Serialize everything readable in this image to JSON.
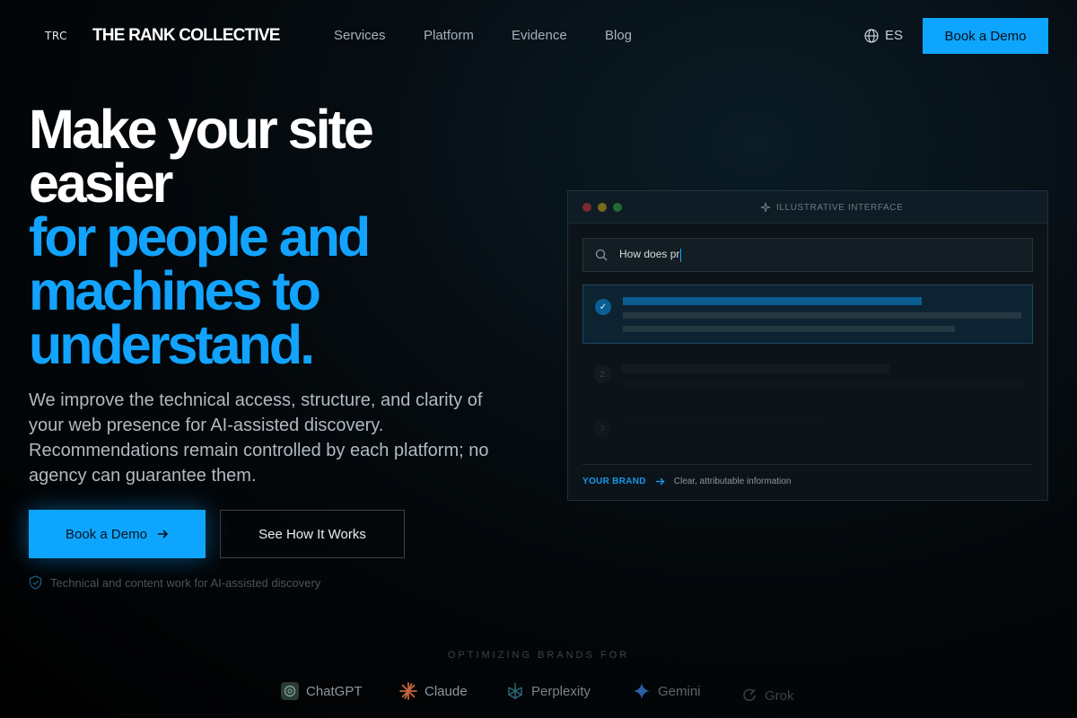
{
  "nav": {
    "logo_mark": "TRC",
    "logo_text": "THE RANK COLLECTIVE",
    "links": [
      "Services",
      "Platform",
      "Evidence",
      "Blog"
    ],
    "language": "ES",
    "cta": "Book a Demo"
  },
  "hero": {
    "title_white": [
      "Make your site",
      "easier"
    ],
    "title_blue": [
      "for people and",
      "machines to",
      "understand."
    ],
    "subtitle": "We improve the technical access, structure, and clarity of your web presence for AI-assisted discovery. Recommendations remain controlled by each platform; no agency can guarantee them.",
    "primary_cta": "Book a Demo",
    "secondary_cta": "See How It Works",
    "trust_note": "Technical and content work for AI-assisted discovery"
  },
  "panel": {
    "label": "ILLUSTRATIVE INTERFACE",
    "search_text": "How does pr",
    "rank_2": "2",
    "rank_3": "3",
    "brand_tag": "YOUR BRAND",
    "brand_note": "Clear, attributable information"
  },
  "platforms": {
    "heading": "OPTIMIZING BRANDS FOR",
    "items": [
      "ChatGPT",
      "Claude",
      "Perplexity",
      "Gemini",
      "Grok"
    ]
  },
  "colors": {
    "accent": "#0ea5ff",
    "headline_blue": "#12a3ff",
    "background": "#000000"
  },
  "icons": {
    "language": "globe-icon",
    "search": "search-icon",
    "arrow": "arrow-right-icon",
    "trust": "shield-icon"
  }
}
